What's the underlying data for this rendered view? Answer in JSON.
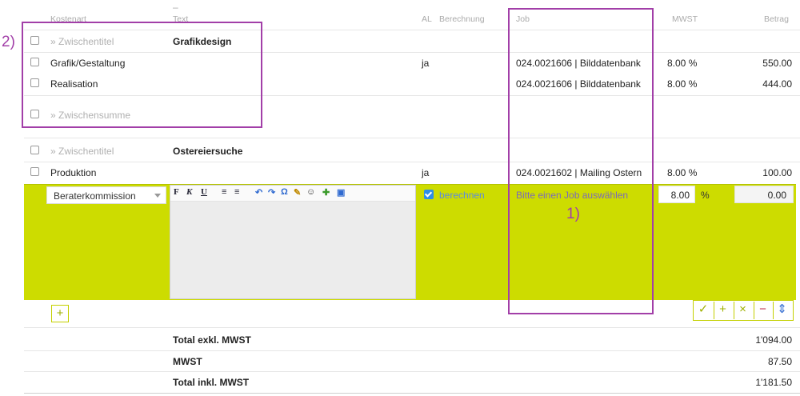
{
  "header": {
    "kostenart": "Kostenart",
    "text": "Text",
    "al": "AL",
    "berechnung": "Berechnung",
    "job": "Job",
    "mwst": "MWST",
    "betrag": "Betrag"
  },
  "rows": [
    {
      "kostenart": "» Zwischentitel",
      "text": "Grafikdesign",
      "al": "",
      "job": "",
      "mwst": "",
      "betrag": ""
    },
    {
      "kostenart": "Grafik/Gestaltung",
      "text": "",
      "al": "ja",
      "job": "024.0021606 | Bilddatenbank",
      "mwst": "8.00 %",
      "betrag": "550.00"
    },
    {
      "kostenart": "Realisation",
      "text": "",
      "al": "",
      "job": "024.0021606 | Bilddatenbank",
      "mwst": "8.00 %",
      "betrag": "444.00"
    },
    {
      "kostenart": "» Zwischensumme",
      "text": "",
      "al": "",
      "job": "",
      "mwst": "",
      "betrag": ""
    },
    {
      "kostenart": "» Zwischentitel",
      "text": "Ostereiersuche",
      "al": "",
      "job": "",
      "mwst": "",
      "betrag": ""
    },
    {
      "kostenart": "Produktion",
      "text": "",
      "al": "ja",
      "job": "024.0021602 | Mailing Ostern",
      "mwst": "8.00 %",
      "betrag": "100.00"
    }
  ],
  "edit_row": {
    "kostenart_value": "Beraterkommission",
    "toolbar": [
      "F",
      "K",
      "U",
      "≡",
      "≡",
      "↶",
      "↷",
      "Ω",
      "✎",
      "☺",
      "✚",
      "▣"
    ],
    "berechnen_label": "berechnen",
    "job_placeholder": "Bitte einen Job auswählen",
    "mwst_value": "8.00",
    "mwst_unit": "%",
    "betrag_value": "0.00"
  },
  "actions": {
    "add": "+",
    "confirm": "✓",
    "plus": "+",
    "cancel": "×",
    "minus": "−",
    "sort": "⇕"
  },
  "totals": [
    {
      "label": "Total exkl. MWST",
      "value": "1'094.00"
    },
    {
      "label": "MWST",
      "value": "87.50"
    },
    {
      "label": "Total inkl. MWST",
      "value": "1'181.50"
    }
  ],
  "annotations": {
    "one": "1)",
    "two": "2)"
  },
  "colors": {
    "edit_band": "#cddc00",
    "annotation": "#a23fa8",
    "accent_blue": "#2f8ee5"
  }
}
